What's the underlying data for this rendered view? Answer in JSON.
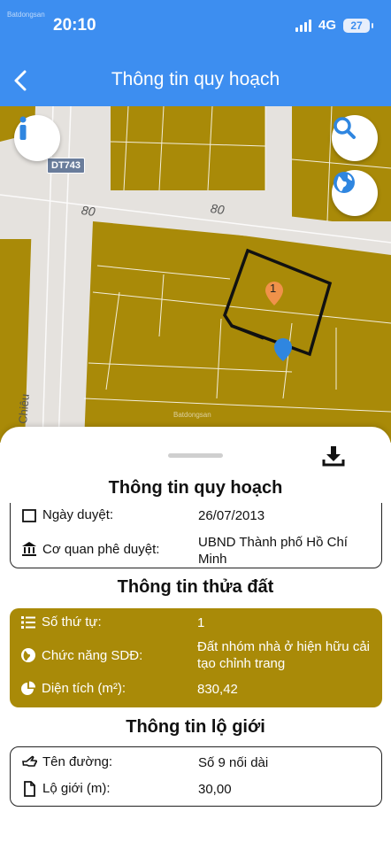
{
  "status": {
    "time": "20:10",
    "network": "4G",
    "battery": "27",
    "watermark": "Batdongsan"
  },
  "header": {
    "title": "Thông tin quy hoạch"
  },
  "map": {
    "road_badge": "DT743",
    "road_label_1": "80",
    "road_label_2": "80",
    "road_name": "Chiêu",
    "parcel_marker": "1",
    "watermark": "Batdongsan",
    "land_color": "#a98a08",
    "road_color": "#e5e2de"
  },
  "sheet": {
    "title": "Thông tin quy hoạch",
    "approval": {
      "date_label": "Ngày duyệt:",
      "date_value": "26/07/2013",
      "agency_label": "Cơ quan phê duyệt:",
      "agency_value": "UBND Thành phố Hồ Chí Minh"
    },
    "parcel_title": "Thông tin thửa đất",
    "parcel": {
      "order_label": "Số thứ tự:",
      "order_value": "1",
      "function_label": "Chức năng SDĐ:",
      "function_value": "Đất nhóm nhà ở hiện hữu cải tạo chỉnh trang",
      "area_label": "Diện tích (m²):",
      "area_value": "830,42"
    },
    "boundary_title": "Thông tin lộ giới",
    "boundary": {
      "street_label": "Tên đường:",
      "street_value": "Số 9 nối dài",
      "width_label": "Lộ giới (m):",
      "width_value": "30,00"
    }
  },
  "colors": {
    "header": "#3d8ef0",
    "accent": "#a98a08",
    "marker_orange": "#f0924a",
    "pin_blue": "#2f86e0"
  },
  "icons": [
    "back-icon",
    "info-icon",
    "search-icon",
    "globe-icon",
    "download-icon",
    "calendar-icon",
    "bank-icon",
    "list-icon",
    "globe-small-icon",
    "pie-chart-icon",
    "hand-pointing-icon",
    "file-icon"
  ]
}
